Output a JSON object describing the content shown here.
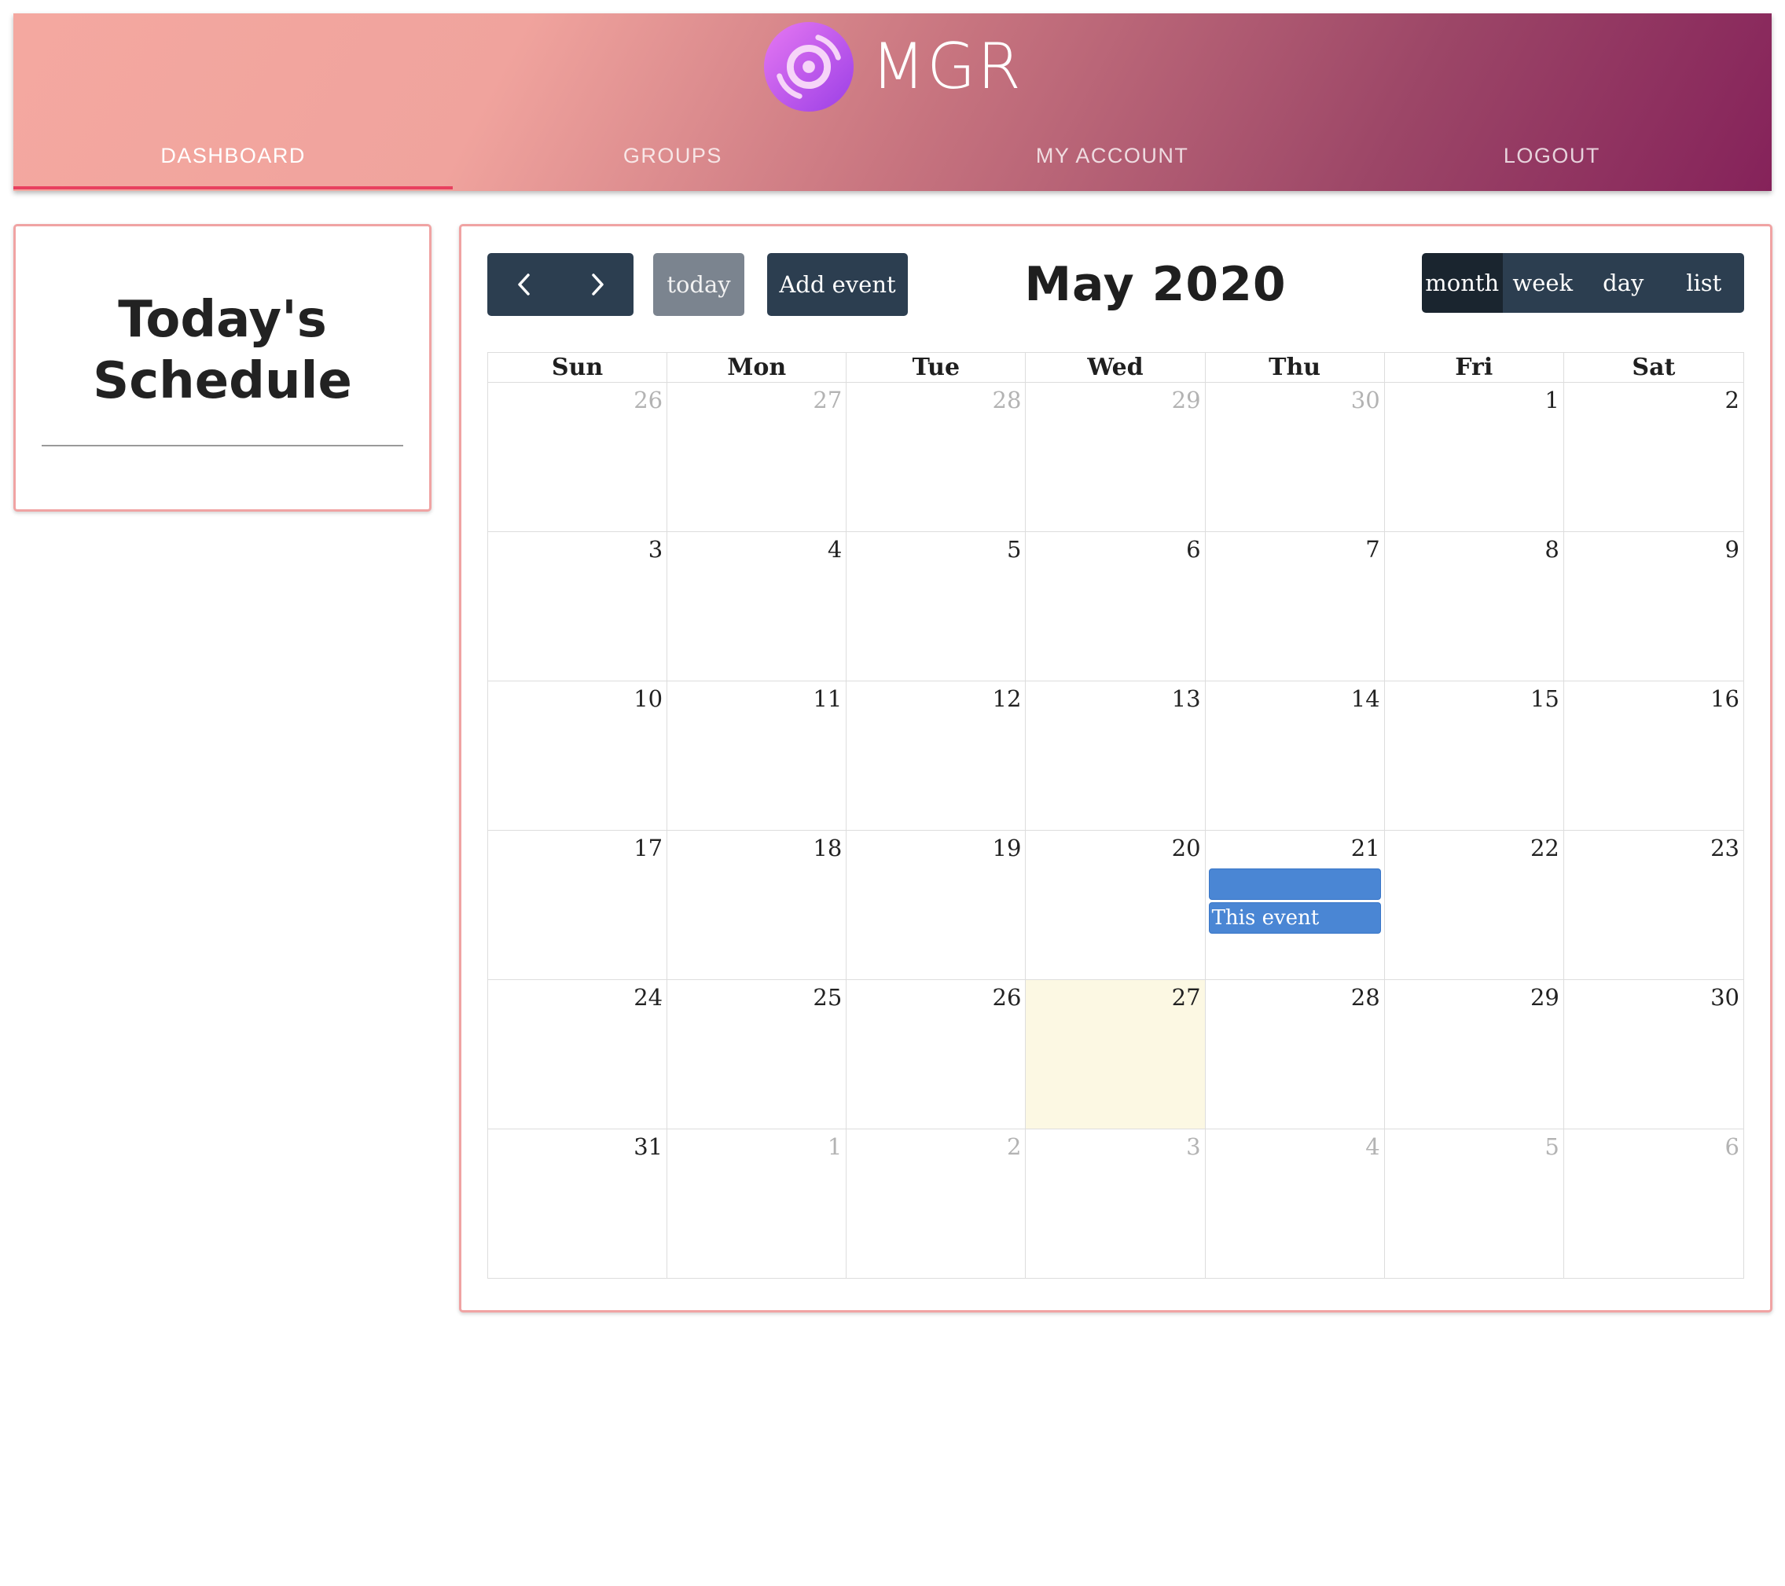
{
  "app": {
    "brand": "MGR"
  },
  "nav": {
    "tabs": [
      {
        "label": "DASHBOARD",
        "active": true
      },
      {
        "label": "GROUPS",
        "active": false
      },
      {
        "label": "MY ACCOUNT",
        "active": false
      },
      {
        "label": "LOGOUT",
        "active": false
      }
    ]
  },
  "schedule": {
    "title": "Today's Schedule"
  },
  "calendar": {
    "title": "May 2020",
    "buttons": {
      "prev_icon": "chevron-left-icon",
      "next_icon": "chevron-right-icon",
      "today": "today",
      "add_event": "Add event"
    },
    "views": [
      {
        "label": "month",
        "active": true
      },
      {
        "label": "week",
        "active": false
      },
      {
        "label": "day",
        "active": false
      },
      {
        "label": "list",
        "active": false
      }
    ],
    "weekdays": [
      "Sun",
      "Mon",
      "Tue",
      "Wed",
      "Thu",
      "Fri",
      "Sat"
    ],
    "weeks": [
      [
        {
          "day": "26",
          "other": true
        },
        {
          "day": "27",
          "other": true
        },
        {
          "day": "28",
          "other": true
        },
        {
          "day": "29",
          "other": true
        },
        {
          "day": "30",
          "other": true
        },
        {
          "day": "1"
        },
        {
          "day": "2"
        }
      ],
      [
        {
          "day": "3"
        },
        {
          "day": "4"
        },
        {
          "day": "5"
        },
        {
          "day": "6"
        },
        {
          "day": "7"
        },
        {
          "day": "8"
        },
        {
          "day": "9"
        }
      ],
      [
        {
          "day": "10"
        },
        {
          "day": "11"
        },
        {
          "day": "12"
        },
        {
          "day": "13"
        },
        {
          "day": "14"
        },
        {
          "day": "15"
        },
        {
          "day": "16"
        }
      ],
      [
        {
          "day": "17"
        },
        {
          "day": "18"
        },
        {
          "day": "19"
        },
        {
          "day": "20"
        },
        {
          "day": "21",
          "events": [
            "",
            "This event"
          ]
        },
        {
          "day": "22"
        },
        {
          "day": "23"
        }
      ],
      [
        {
          "day": "24"
        },
        {
          "day": "25"
        },
        {
          "day": "26"
        },
        {
          "day": "27",
          "today": true
        },
        {
          "day": "28"
        },
        {
          "day": "29"
        },
        {
          "day": "30"
        }
      ],
      [
        {
          "day": "31"
        },
        {
          "day": "1",
          "other": true
        },
        {
          "day": "2",
          "other": true
        },
        {
          "day": "3",
          "other": true
        },
        {
          "day": "4",
          "other": true
        },
        {
          "day": "5",
          "other": true
        },
        {
          "day": "6",
          "other": true
        }
      ]
    ]
  },
  "colors": {
    "header_gradient_start": "#f4a8a0",
    "header_gradient_end": "#85225a",
    "active_tab_underline": "#e8405f",
    "card_border": "#f0a3a3",
    "button_dark": "#2c3e50",
    "button_active": "#1a252f",
    "button_today": "#7b848f",
    "event_blue": "#4a86d4",
    "today_highlight": "#fcf8e3",
    "logo_purple": "#b65cf0"
  }
}
